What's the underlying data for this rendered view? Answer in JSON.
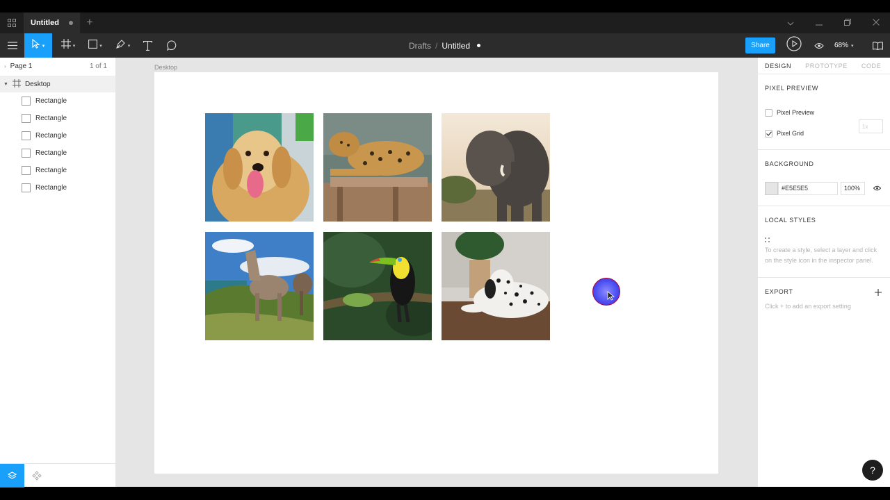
{
  "titlebar": {
    "tab_title": "Untitled",
    "window_controls": [
      "chevron-down-icon",
      "minimize-icon",
      "restore-icon",
      "close-icon"
    ]
  },
  "toolbar": {
    "breadcrumb_root": "Drafts",
    "breadcrumb_sep": "/",
    "file_title": "Untitled",
    "share_label": "Share",
    "zoom_label": "68%",
    "tools": [
      "menu-icon",
      "move-tool-icon",
      "frame-tool-icon",
      "shape-tool-icon",
      "pen-tool-icon",
      "text-tool-icon",
      "comment-tool-icon"
    ],
    "accent": "#18a0fb"
  },
  "layers": {
    "page_label": "Page 1",
    "page_count": "1 of 1",
    "frame_name": "Desktop",
    "items": [
      {
        "label": "Rectangle"
      },
      {
        "label": "Rectangle"
      },
      {
        "label": "Rectangle"
      },
      {
        "label": "Rectangle"
      },
      {
        "label": "Rectangle"
      },
      {
        "label": "Rectangle"
      }
    ]
  },
  "canvas": {
    "frame_label": "Desktop",
    "background": "#e5e5e5",
    "photos": [
      "golden retriever dog",
      "leopard on platform",
      "elephant",
      "horses on cliff",
      "toucan on branch",
      "dalmatian lying down"
    ]
  },
  "inspector": {
    "tabs": [
      "DESIGN",
      "PROTOTYPE",
      "CODE"
    ],
    "pixel_preview_head": "PIXEL PREVIEW",
    "pixel_preview_label": "Pixel Preview",
    "pixel_preview_checked": false,
    "pixel_preview_scale": "1x",
    "pixel_grid_label": "Pixel Grid",
    "pixel_grid_checked": true,
    "background_head": "BACKGROUND",
    "background_hex": "#E5E5E5",
    "background_opacity": "100%",
    "local_styles_head": "LOCAL STYLES",
    "local_styles_hint": "To create a style, select a layer and click on the style icon in the inspector panel.",
    "export_head": "EXPORT",
    "export_hint": "Click + to add an export setting",
    "help_label": "?"
  }
}
